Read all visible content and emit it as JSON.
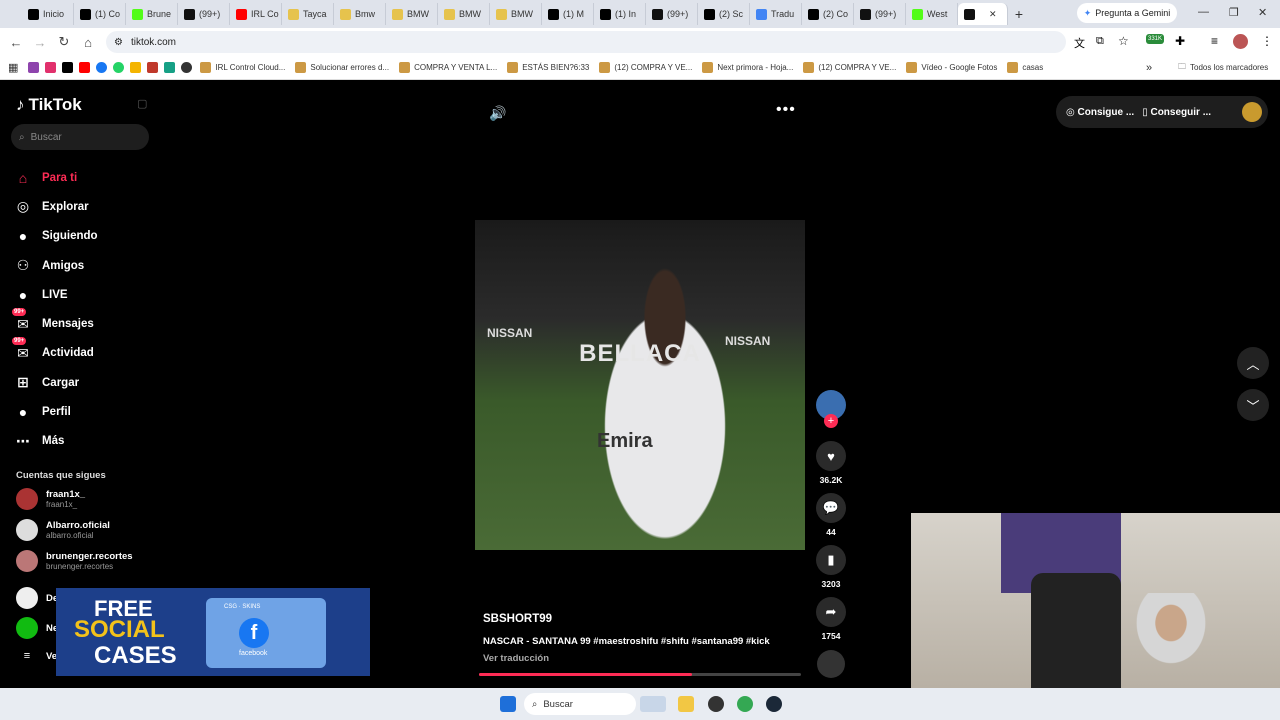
{
  "browser": {
    "tabs": [
      {
        "label": "Inicio",
        "icon": "x-icon"
      },
      {
        "label": "(1) Co",
        "icon": "x-icon"
      },
      {
        "label": "Brune",
        "icon": "kick-icon"
      },
      {
        "label": "(99+)",
        "icon": "tiktok-icon"
      },
      {
        "label": "IRL Co",
        "icon": "youtube-icon"
      },
      {
        "label": "Tayca",
        "icon": "sheet-icon"
      },
      {
        "label": "Bmw",
        "icon": "sheet-icon"
      },
      {
        "label": "BMW",
        "icon": "sheet-icon"
      },
      {
        "label": "BMW",
        "icon": "sheet-icon"
      },
      {
        "label": "BMW",
        "icon": "sheet-icon"
      },
      {
        "label": "(1) M",
        "icon": "x-icon"
      },
      {
        "label": "(1) In",
        "icon": "x-icon"
      },
      {
        "label": "(99+)",
        "icon": "tiktok-icon"
      },
      {
        "label": "(2) Sc",
        "icon": "x-icon"
      },
      {
        "label": "Tradu",
        "icon": "translate-icon"
      },
      {
        "label": "(2) Co",
        "icon": "x-icon"
      },
      {
        "label": "(99+)",
        "icon": "tiktok-icon"
      },
      {
        "label": "West",
        "icon": "kick-icon"
      },
      {
        "label": "",
        "icon": "tiktok-icon",
        "active": true
      }
    ],
    "gemini_label": "Pregunta a Gemini",
    "url": "tiktok.com",
    "extension_badge": "331K",
    "bookmarks": [
      {
        "label": "IRL Control Cloud..."
      },
      {
        "label": "Solucionar errores d..."
      },
      {
        "label": "COMPRA Y VENTA L..."
      },
      {
        "label": "ESTÁS BIEN?6:33"
      },
      {
        "label": "(12) COMPRA Y VE..."
      },
      {
        "label": "Next primora - Hoja..."
      },
      {
        "label": "(12) COMPRA Y VE..."
      },
      {
        "label": "Vídeo - Google Fotos"
      },
      {
        "label": "casas"
      }
    ],
    "all_bookmarks": "Todos los marcadores"
  },
  "tiktok": {
    "brand": "TikTok",
    "search_placeholder": "Buscar",
    "nav": [
      {
        "label": "Para ti",
        "icon": "home-icon"
      },
      {
        "label": "Explorar",
        "icon": "compass-icon"
      },
      {
        "label": "Siguiendo",
        "icon": "following-icon"
      },
      {
        "label": "Amigos",
        "icon": "friends-icon"
      },
      {
        "label": "LIVE",
        "icon": "live-icon"
      },
      {
        "label": "Mensajes",
        "icon": "messages-icon",
        "badge": "99+"
      },
      {
        "label": "Actividad",
        "icon": "activity-icon",
        "badge": "99+"
      },
      {
        "label": "Cargar",
        "icon": "upload-icon"
      },
      {
        "label": "Perfil",
        "icon": "profile-icon"
      },
      {
        "label": "Más",
        "icon": "more-icon"
      }
    ],
    "following_title": "Cuentas que sigues",
    "following": [
      {
        "name": "fraan1x_",
        "handle": "fraan1x_"
      },
      {
        "name": "Albarro.oficial",
        "handle": "albarro.oficial"
      },
      {
        "name": "brunenger.recortes",
        "handle": "brunenger.recortes"
      }
    ],
    "following_partial": [
      "De",
      "Ne",
      "Ve"
    ],
    "top_right": {
      "coins_label": "Consigue ...",
      "app_label": "Conseguir ..."
    },
    "video": {
      "overlay_text": "BELLACA",
      "author": "SBSHORT99",
      "description": "NASCAR - SANTANA 99 #maestroshifu #shifu #santana99 #kick",
      "translate": "Ver traducción",
      "progress": 0.66,
      "likes": "36.2K",
      "comments": "44",
      "saves": "3203",
      "shares": "1754"
    }
  },
  "ad": {
    "line1": "FREE",
    "line2": "SOCIAL",
    "line3": "CASES",
    "brand": "CSG · SKINS",
    "platform": "facebook"
  },
  "taskbar": {
    "search_label": "Buscar"
  }
}
